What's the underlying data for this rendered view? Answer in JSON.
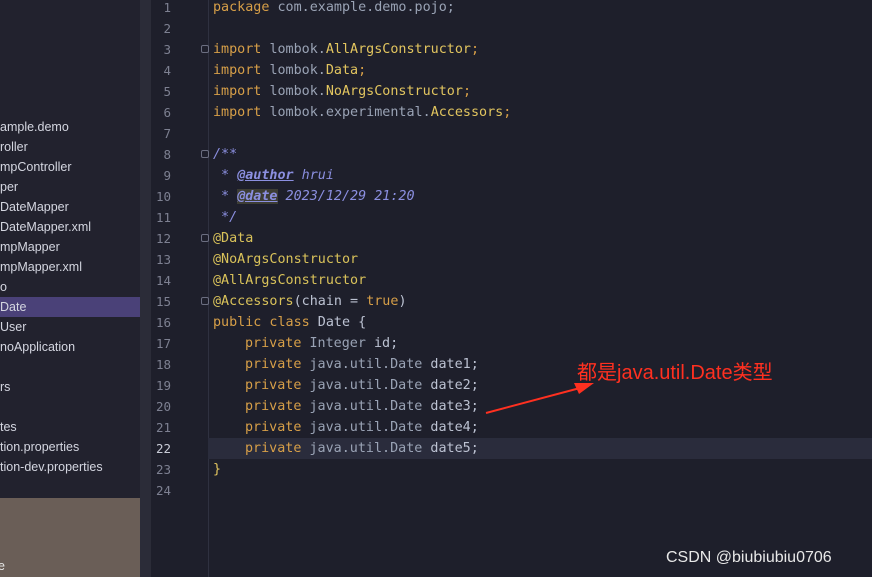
{
  "sidebar": {
    "items": [
      "ample.demo",
      "roller",
      "mpController",
      "per",
      "DateMapper",
      "DateMapper.xml",
      "mpMapper",
      "mpMapper.xml",
      "o",
      "Date",
      "User",
      "noApplication",
      "",
      "rs",
      "",
      "tes",
      "tion.properties",
      "tion-dev.properties"
    ],
    "selected_index": 9,
    "bottom_label": "e"
  },
  "gutter": {
    "line_numbers": [
      "1",
      "2",
      "3",
      "4",
      "5",
      "6",
      "7",
      "8",
      "9",
      "10",
      "11",
      "12",
      "13",
      "14",
      "15",
      "16",
      "17",
      "18",
      "19",
      "20",
      "21",
      "22",
      "23",
      "24"
    ],
    "current_line": "22"
  },
  "code": {
    "l1_kw": "package",
    "l1_pkg": "com.example.demo.pojo;",
    "imp_kw": "import",
    "l3_pkg": "lombok.",
    "l3_cls": "AllArgsConstructor",
    "l4_pkg": "lombok.",
    "l4_cls": "Data",
    "l5_pkg": "lombok.",
    "l5_cls": "NoArgsConstructor",
    "l6_pkg": "lombok.experimental.",
    "l6_cls": "Accessors",
    "semi": ";",
    "l8": "/**",
    "l9_star": " * ",
    "l9_tag": "@author",
    "l9_val": " hrui",
    "l10_star": " * ",
    "l10_tag": "@date",
    "l10_val": " 2023/12/29 21:20",
    "l11": " */",
    "l12": "@Data",
    "l13": "@NoArgsConstructor",
    "l14": "@AllArgsConstructor",
    "l15_ann": "@Accessors",
    "l15_open": "(chain = ",
    "l15_true": "true",
    "l15_close": ")",
    "l16_kw": "public class",
    "l16_name": " Date {",
    "private_kw": "private",
    "l17_type": "Integer",
    "l17_name": " id;",
    "date_type": "java.util.Date",
    "f1": " date1;",
    "f2": " date2;",
    "f3": " date3;",
    "f4": " date4;",
    "f5": " date5;",
    "l23": "}"
  },
  "annotation_text": "都是java.util.Date类型",
  "watermark": "CSDN @biubiubiu0706",
  "colors": {
    "annotation_red": "#ff3020",
    "selection": "#4a4178",
    "editor_bg": "#1e1f2b"
  }
}
